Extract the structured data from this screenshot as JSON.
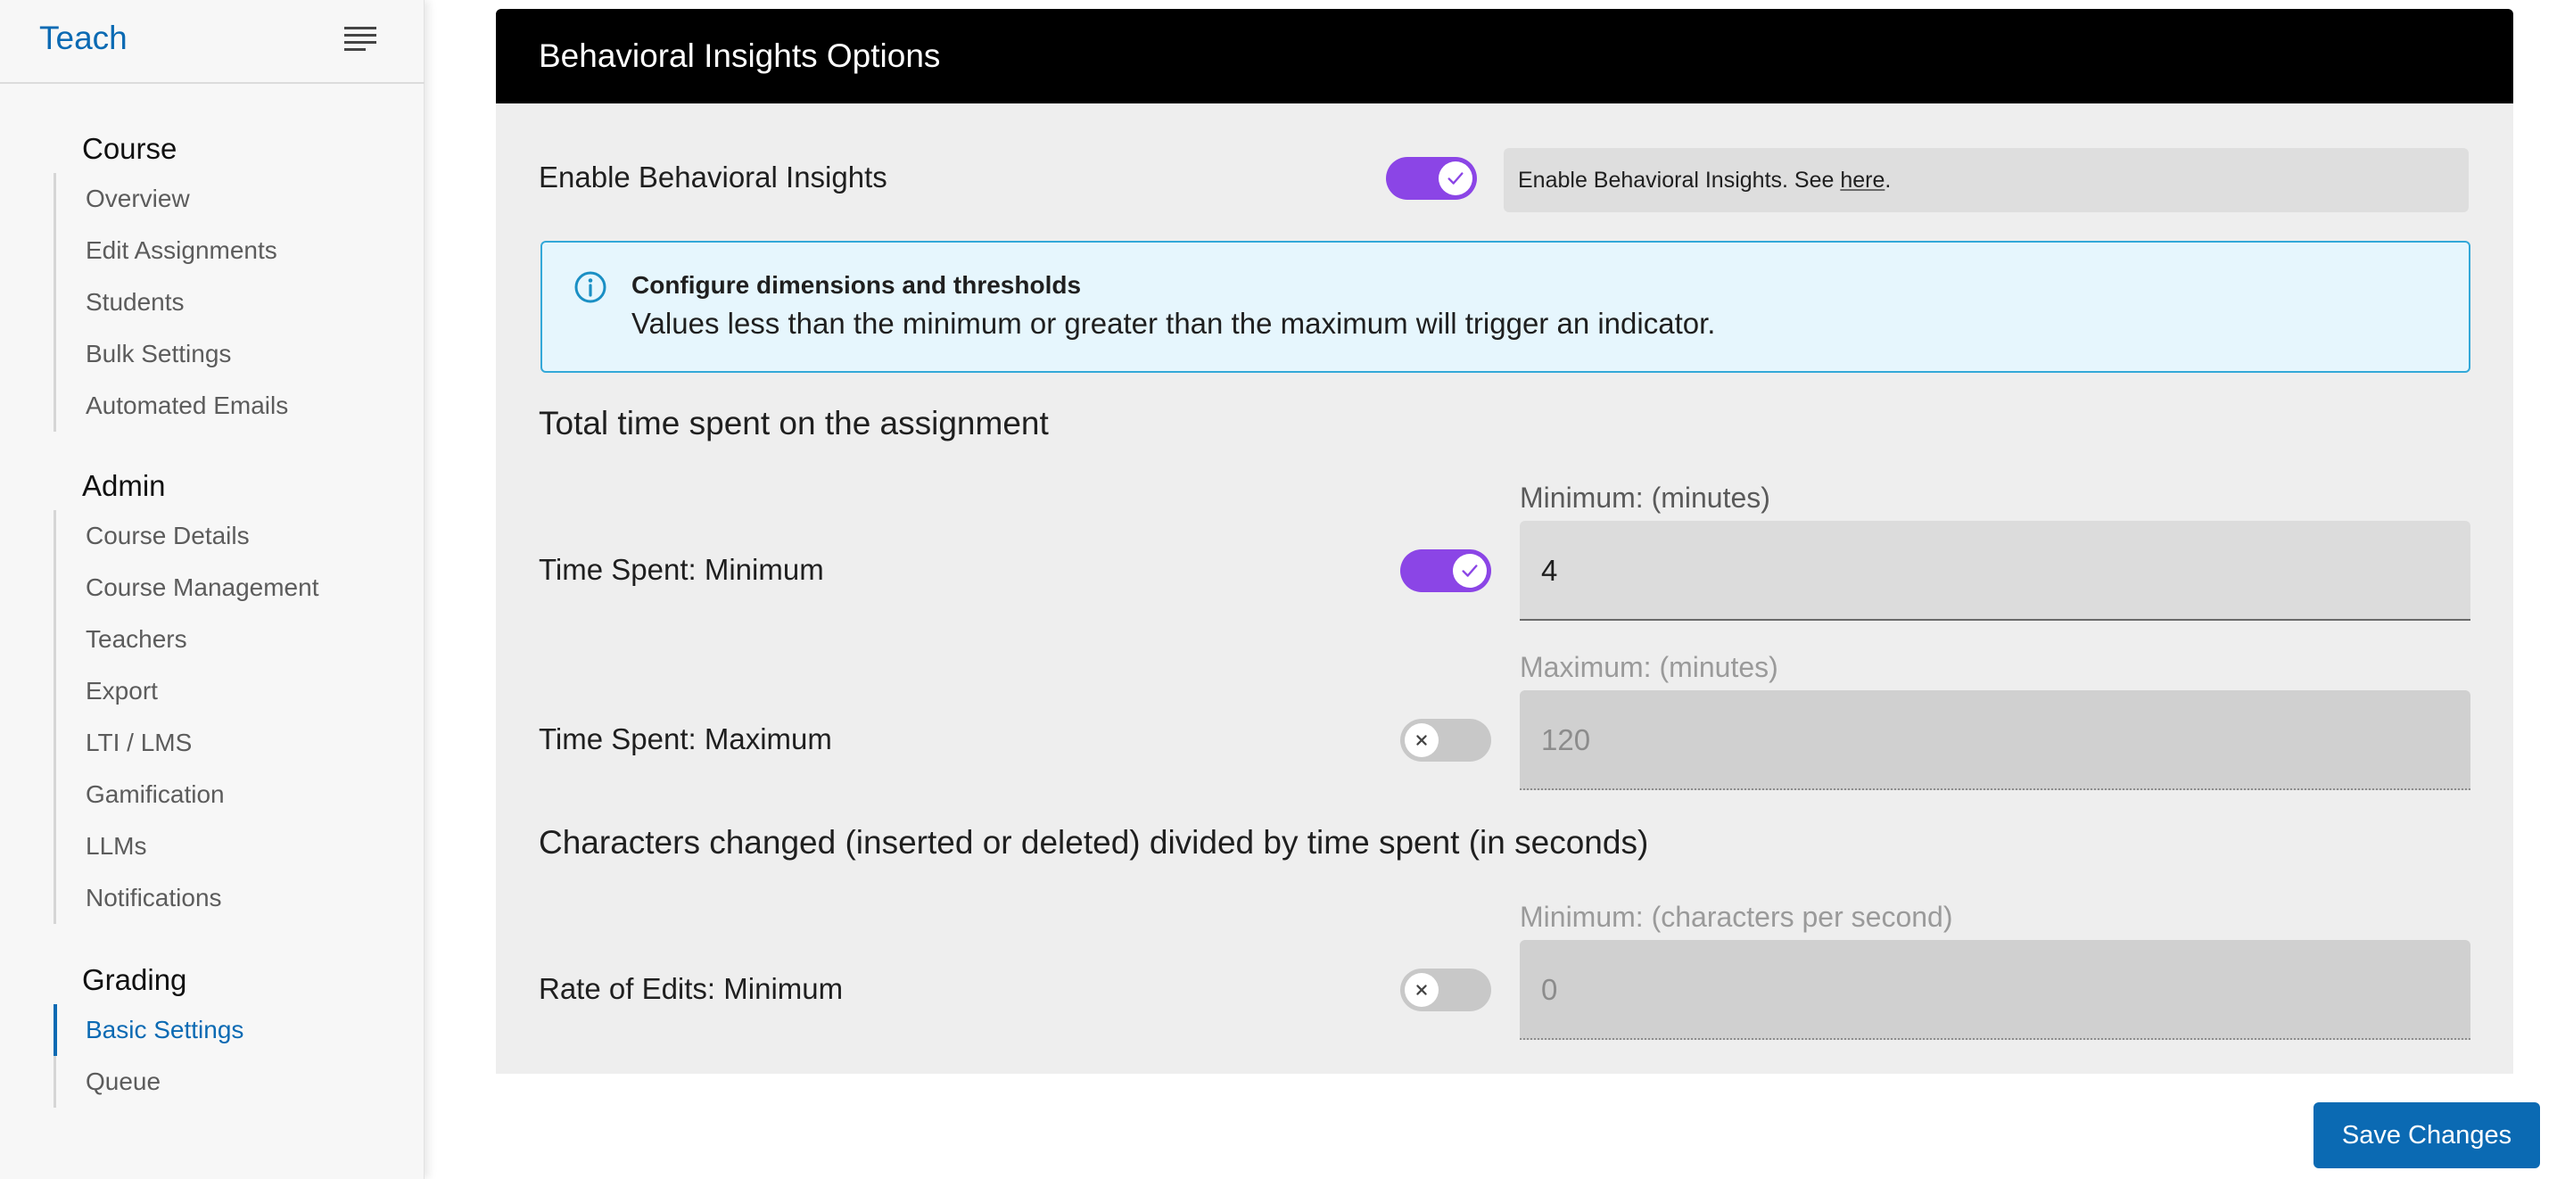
{
  "sidebar": {
    "brand": "Teach",
    "groups": [
      {
        "title": "Course",
        "items": [
          "Overview",
          "Edit Assignments",
          "Students",
          "Bulk Settings",
          "Automated Emails"
        ]
      },
      {
        "title": "Admin",
        "items": [
          "Course Details",
          "Course Management",
          "Teachers",
          "Export",
          "LTI / LMS",
          "Gamification",
          "LLMs",
          "Notifications"
        ]
      },
      {
        "title": "Grading",
        "items": [
          "Basic Settings",
          "Queue"
        ],
        "active": "Basic Settings"
      }
    ]
  },
  "panel": {
    "title": "Behavioral Insights Options",
    "enable": {
      "label": "Enable Behavioral Insights",
      "state": "on",
      "help_prefix": "Enable Behavioral Insights. See ",
      "help_link": "here",
      "help_suffix": "."
    },
    "info": {
      "title": "Configure dimensions and thresholds",
      "text": "Values less than the minimum or greater than the maximum will trigger an indicator."
    },
    "sections": [
      {
        "title": "Total time spent on the assignment",
        "rows": [
          {
            "label": "Time Spent: Minimum",
            "state": "on",
            "field_label": "Minimum: (minutes)",
            "value": "4"
          },
          {
            "label": "Time Spent: Maximum",
            "state": "off",
            "field_label": "Maximum: (minutes)",
            "value": "120"
          }
        ]
      },
      {
        "title": "Characters changed (inserted or deleted) divided by time spent (in seconds)",
        "rows": [
          {
            "label": "Rate of Edits: Minimum",
            "state": "off",
            "field_label": "Minimum: (characters per second)",
            "value": "0"
          }
        ]
      }
    ]
  },
  "actions": {
    "save_label": "Save Changes"
  },
  "colors": {
    "accent": "#0b6ab3",
    "toggle_on": "#8b45e6",
    "info_border": "#33a8d8"
  }
}
